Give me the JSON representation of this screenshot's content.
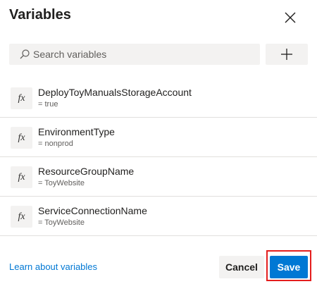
{
  "dialog": {
    "title": "Variables",
    "close_icon": "close-icon"
  },
  "search": {
    "placeholder": "Search variables",
    "icon": "search-icon",
    "value": ""
  },
  "add_button": {
    "icon": "plus-icon"
  },
  "variables": [
    {
      "icon_label": "fx",
      "name": "DeployToyManualsStorageAccount",
      "value": "= true"
    },
    {
      "icon_label": "fx",
      "name": "EnvironmentType",
      "value": "= nonprod"
    },
    {
      "icon_label": "fx",
      "name": "ResourceGroupName",
      "value": "= ToyWebsite"
    },
    {
      "icon_label": "fx",
      "name": "ServiceConnectionName",
      "value": "= ToyWebsite"
    }
  ],
  "footer": {
    "learn_link": "Learn about variables",
    "cancel_label": "Cancel",
    "save_label": "Save"
  },
  "colors": {
    "accent": "#0078d4",
    "highlight": "#e41e1e",
    "surface": "#f3f2f1"
  }
}
